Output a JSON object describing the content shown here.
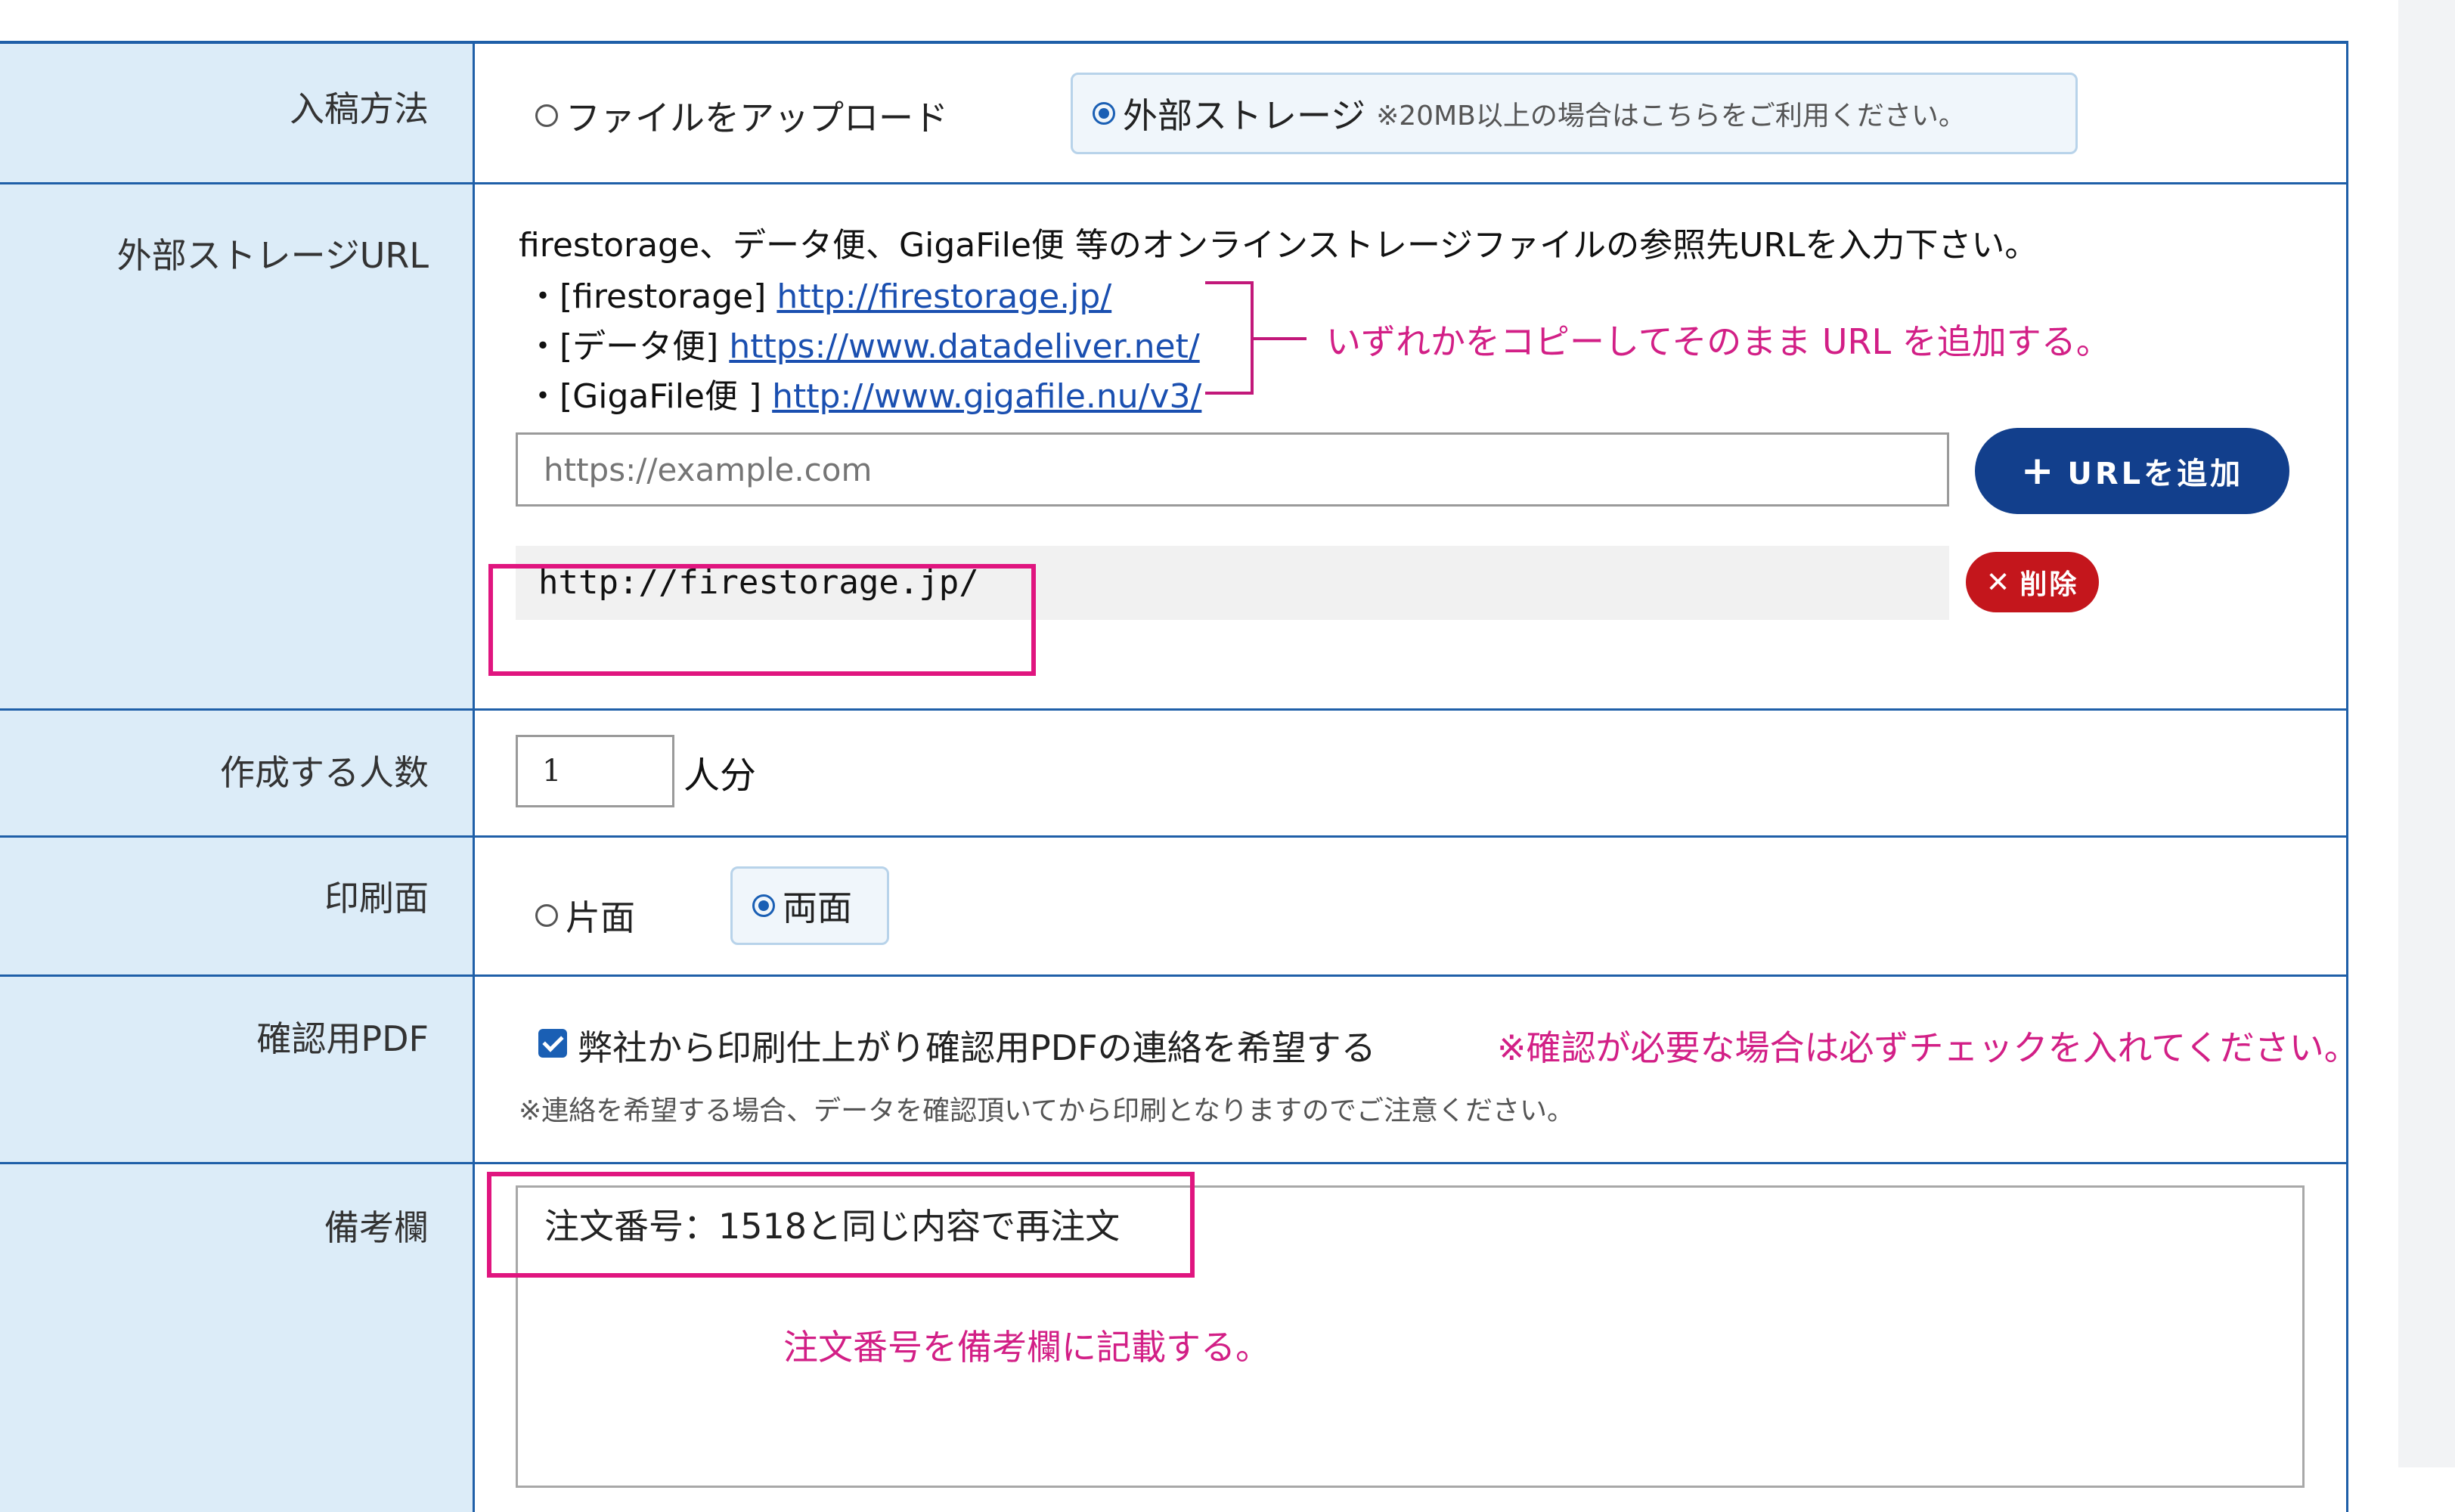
{
  "upload_method": {
    "label": "入稿方法",
    "options": [
      {
        "label": "ファイルをアップロード",
        "selected": false
      },
      {
        "label": "外部ストレージ",
        "selected": true,
        "note": "※20MB以上の場合はこちらをご利用ください。"
      }
    ]
  },
  "external_storage": {
    "label": "外部ストレージURL",
    "description": "firestorage、データ便、GigaFile便 等のオンラインストレージファイルの参照先URLを入力下さい。",
    "services": [
      {
        "prefix": "・[firestorage] ",
        "url": "http://firestorage.jp/"
      },
      {
        "prefix": "・[データ便] ",
        "url": "https://www.datadeliver.net/"
      },
      {
        "prefix": "・[GigaFile便 ] ",
        "url": "http://www.gigafile.nu/v3/"
      }
    ],
    "annotation": "いずれかをコピーしてそのまま URL を追加する。",
    "input_placeholder": "https://example.com",
    "add_button_label": "URLを追加",
    "added_url": "http://firestorage.jp/",
    "delete_button_label": "削除"
  },
  "people_count": {
    "label": "作成する人数",
    "value": "1",
    "unit": "人分"
  },
  "print_side": {
    "label": "印刷面",
    "options": [
      {
        "label": "片面",
        "selected": false
      },
      {
        "label": "両面",
        "selected": true
      }
    ]
  },
  "confirm_pdf": {
    "label": "確認用PDF",
    "checkbox_label": "弊社から印刷仕上がり確認用PDFの連絡を希望する",
    "checked": true,
    "annotation": "※確認が必要な場合は必ずチェックを入れてください。",
    "note": "※連絡を希望する場合、データを確認頂いてから印刷となりますのでご注意ください。"
  },
  "remarks": {
    "label": "備考欄",
    "value": "注文番号：1518と同じ内容で再注文",
    "annotation": "注文番号を備考欄に記載する。"
  },
  "colors": {
    "border": "#1f5fa8",
    "label_bg": "#dcecf8",
    "accent_pink": "#e0157f",
    "primary_button": "#123f8c",
    "danger_button": "#c4161c"
  }
}
